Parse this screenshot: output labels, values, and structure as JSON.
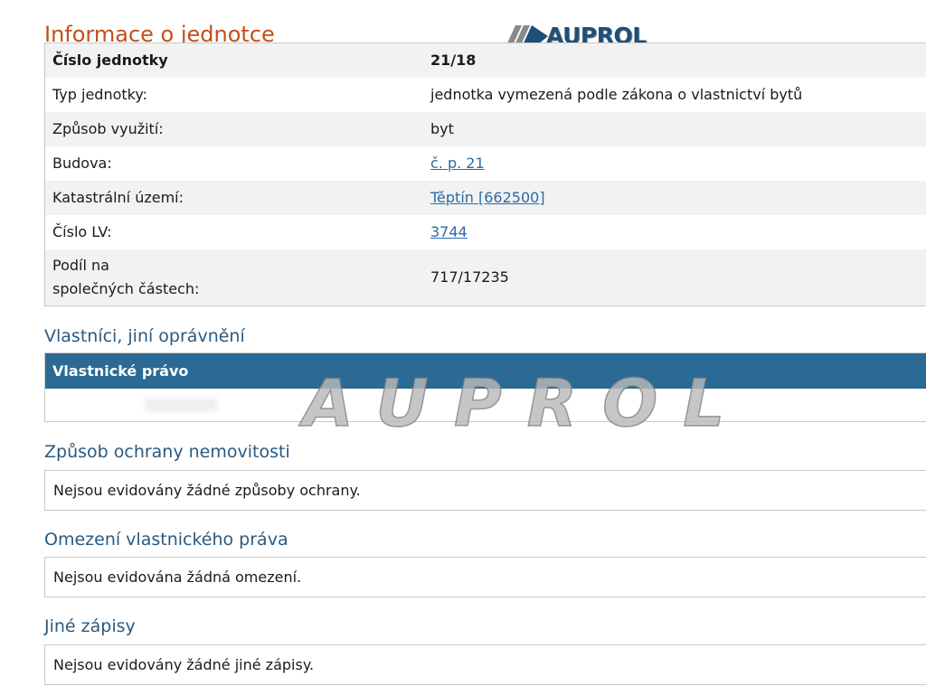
{
  "page_title": "Informace o jednotce",
  "logo": {
    "text": "AUPROL",
    "watermark": "AUPROL",
    "color": "#1f4e79"
  },
  "info_table": {
    "rows": [
      {
        "key": "Číslo jednotky",
        "value": "21/18",
        "link": false
      },
      {
        "key": "Typ jednotky:",
        "value": "jednotka vymezená podle zákona o vlastnictví bytů",
        "link": false
      },
      {
        "key": "Způsob využití:",
        "value": "byt",
        "link": false
      },
      {
        "key": "Budova:",
        "value": "č. p. 21",
        "link": true
      },
      {
        "key": "Katastrální území:",
        "value": "Těptín [662500]",
        "link": true
      },
      {
        "key": "Číslo LV:",
        "value": "3744",
        "link": true
      },
      {
        "key_line1": "Podíl na",
        "key_line2": "společných částech:",
        "value": "717/17235",
        "link": false
      }
    ]
  },
  "owners": {
    "heading": "Vlastníci, jiní oprávnění",
    "table_header": "Vlastnické právo"
  },
  "protection": {
    "heading": "Způsob ochrany nemovitosti",
    "text": "Nejsou evidovány žádné způsoby ochrany."
  },
  "restrictions": {
    "heading": "Omezení vlastnického práva",
    "text": "Nejsou evidována žádná omezení."
  },
  "other": {
    "heading": "Jiné zápisy",
    "text": "Nejsou evidovány žádné jiné zápisy."
  },
  "colors": {
    "title": "#c0501a",
    "heading": "#2b5a7f",
    "link": "#2b6aa6",
    "table_header_bg": "#2a6a94"
  }
}
